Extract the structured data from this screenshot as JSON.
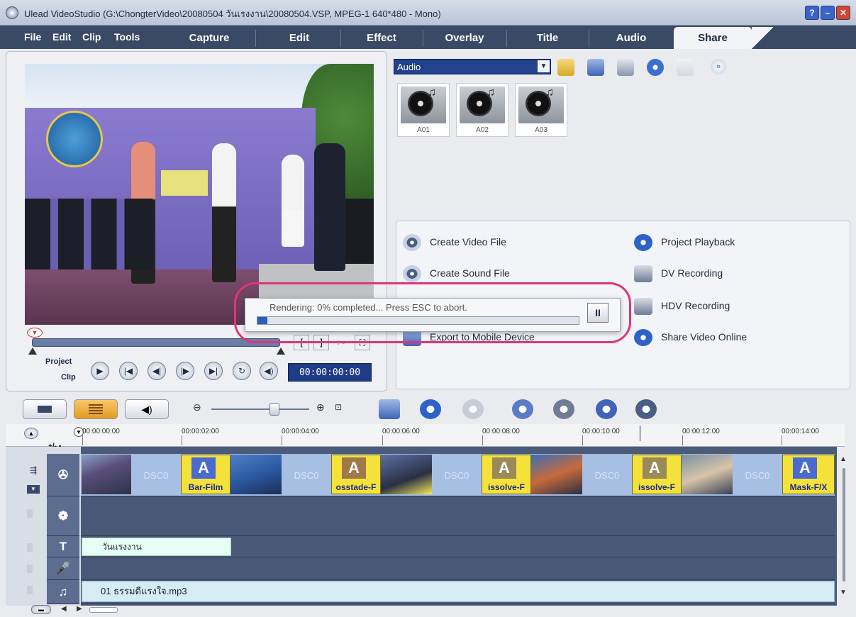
{
  "window": {
    "title": "Ulead VideoStudio (G:\\ChongterVideo\\20080504 วันเรงงาน\\20080504.VSP, MPEG-1 640*480 - Mono)"
  },
  "menu": {
    "items": [
      "File",
      "Edit",
      "Clip",
      "Tools"
    ]
  },
  "tabs": [
    "Capture",
    "Edit",
    "Effect",
    "Overlay",
    "Title",
    "Audio",
    "Share"
  ],
  "active_tab": "Share",
  "preview": {
    "project_label": "Project",
    "clip_label": "Clip",
    "timecode": "00:00:00:00",
    "marker_in": "[",
    "marker_out": "]"
  },
  "library": {
    "dropdown_value": "Audio",
    "items": [
      {
        "label": "A01"
      },
      {
        "label": "A02"
      },
      {
        "label": "A03"
      }
    ]
  },
  "share_options": {
    "create_video_file": "Create Video File",
    "create_sound_file": "Create Sound File",
    "export_mobile": "Export to Mobile Device",
    "project_playback": "Project Playback",
    "dv_recording": "DV Recording",
    "hdv_recording": "HDV Recording",
    "share_video_online": "Share Video Online"
  },
  "render_dialog": {
    "message": "Rendering:  0% completed... Press ESC to abort.",
    "progress_percent": 0,
    "pause_label": "II"
  },
  "ruler": {
    "ticks": [
      "00:00:00:00",
      "00:00:02:00",
      "00:00:04:00",
      "00:00:06:00",
      "00:00:08:00",
      "00:00:10:00",
      "00:00:12:00",
      "00:00:14:00"
    ],
    "plus_minus": "+/- ▪"
  },
  "tracks": {
    "video_clips": [
      {
        "kind": "photo",
        "text": ""
      },
      {
        "kind": "dsc",
        "text": "DSC0"
      },
      {
        "kind": "transition",
        "text": "Bar-Film"
      },
      {
        "kind": "photo",
        "text": ""
      },
      {
        "kind": "dsc",
        "text": "DSC0"
      },
      {
        "kind": "transition",
        "text": "osstade-F"
      },
      {
        "kind": "photo",
        "text": ""
      },
      {
        "kind": "dsc",
        "text": "DSC0"
      },
      {
        "kind": "transition",
        "text": "issolve-F"
      },
      {
        "kind": "photo",
        "text": ""
      },
      {
        "kind": "dsc",
        "text": "DSC0"
      },
      {
        "kind": "transition",
        "text": "issolve-F"
      },
      {
        "kind": "photo",
        "text": ""
      },
      {
        "kind": "dsc",
        "text": "DSC0"
      },
      {
        "kind": "transition",
        "text": "Mask-F/X"
      }
    ],
    "title_clip": "วันแรงงาน",
    "audio_clip": "01 ธรรมดีแรงใจ.mp3"
  },
  "colors": {
    "accent_blue": "#23418c",
    "transition_yellow": "#f4e23a",
    "highlight_pink": "#e2347a",
    "tab_bar": "#3a4a66"
  }
}
